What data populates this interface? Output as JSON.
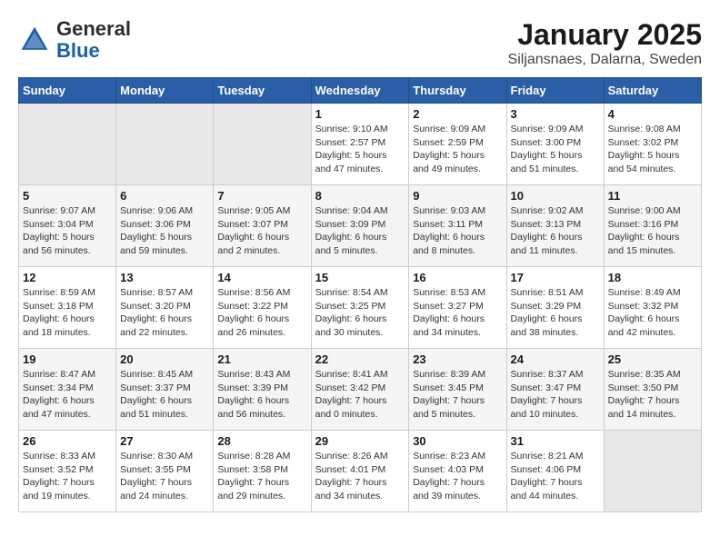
{
  "header": {
    "logo_general": "General",
    "logo_blue": "Blue",
    "month_title": "January 2025",
    "location": "Siljansnaes, Dalarna, Sweden"
  },
  "weekdays": [
    "Sunday",
    "Monday",
    "Tuesday",
    "Wednesday",
    "Thursday",
    "Friday",
    "Saturday"
  ],
  "weeks": [
    [
      {
        "day": "",
        "info": ""
      },
      {
        "day": "",
        "info": ""
      },
      {
        "day": "",
        "info": ""
      },
      {
        "day": "1",
        "info": "Sunrise: 9:10 AM\nSunset: 2:57 PM\nDaylight: 5 hours\nand 47 minutes."
      },
      {
        "day": "2",
        "info": "Sunrise: 9:09 AM\nSunset: 2:59 PM\nDaylight: 5 hours\nand 49 minutes."
      },
      {
        "day": "3",
        "info": "Sunrise: 9:09 AM\nSunset: 3:00 PM\nDaylight: 5 hours\nand 51 minutes."
      },
      {
        "day": "4",
        "info": "Sunrise: 9:08 AM\nSunset: 3:02 PM\nDaylight: 5 hours\nand 54 minutes."
      }
    ],
    [
      {
        "day": "5",
        "info": "Sunrise: 9:07 AM\nSunset: 3:04 PM\nDaylight: 5 hours\nand 56 minutes."
      },
      {
        "day": "6",
        "info": "Sunrise: 9:06 AM\nSunset: 3:06 PM\nDaylight: 5 hours\nand 59 minutes."
      },
      {
        "day": "7",
        "info": "Sunrise: 9:05 AM\nSunset: 3:07 PM\nDaylight: 6 hours\nand 2 minutes."
      },
      {
        "day": "8",
        "info": "Sunrise: 9:04 AM\nSunset: 3:09 PM\nDaylight: 6 hours\nand 5 minutes."
      },
      {
        "day": "9",
        "info": "Sunrise: 9:03 AM\nSunset: 3:11 PM\nDaylight: 6 hours\nand 8 minutes."
      },
      {
        "day": "10",
        "info": "Sunrise: 9:02 AM\nSunset: 3:13 PM\nDaylight: 6 hours\nand 11 minutes."
      },
      {
        "day": "11",
        "info": "Sunrise: 9:00 AM\nSunset: 3:16 PM\nDaylight: 6 hours\nand 15 minutes."
      }
    ],
    [
      {
        "day": "12",
        "info": "Sunrise: 8:59 AM\nSunset: 3:18 PM\nDaylight: 6 hours\nand 18 minutes."
      },
      {
        "day": "13",
        "info": "Sunrise: 8:57 AM\nSunset: 3:20 PM\nDaylight: 6 hours\nand 22 minutes."
      },
      {
        "day": "14",
        "info": "Sunrise: 8:56 AM\nSunset: 3:22 PM\nDaylight: 6 hours\nand 26 minutes."
      },
      {
        "day": "15",
        "info": "Sunrise: 8:54 AM\nSunset: 3:25 PM\nDaylight: 6 hours\nand 30 minutes."
      },
      {
        "day": "16",
        "info": "Sunrise: 8:53 AM\nSunset: 3:27 PM\nDaylight: 6 hours\nand 34 minutes."
      },
      {
        "day": "17",
        "info": "Sunrise: 8:51 AM\nSunset: 3:29 PM\nDaylight: 6 hours\nand 38 minutes."
      },
      {
        "day": "18",
        "info": "Sunrise: 8:49 AM\nSunset: 3:32 PM\nDaylight: 6 hours\nand 42 minutes."
      }
    ],
    [
      {
        "day": "19",
        "info": "Sunrise: 8:47 AM\nSunset: 3:34 PM\nDaylight: 6 hours\nand 47 minutes."
      },
      {
        "day": "20",
        "info": "Sunrise: 8:45 AM\nSunset: 3:37 PM\nDaylight: 6 hours\nand 51 minutes."
      },
      {
        "day": "21",
        "info": "Sunrise: 8:43 AM\nSunset: 3:39 PM\nDaylight: 6 hours\nand 56 minutes."
      },
      {
        "day": "22",
        "info": "Sunrise: 8:41 AM\nSunset: 3:42 PM\nDaylight: 7 hours\nand 0 minutes."
      },
      {
        "day": "23",
        "info": "Sunrise: 8:39 AM\nSunset: 3:45 PM\nDaylight: 7 hours\nand 5 minutes."
      },
      {
        "day": "24",
        "info": "Sunrise: 8:37 AM\nSunset: 3:47 PM\nDaylight: 7 hours\nand 10 minutes."
      },
      {
        "day": "25",
        "info": "Sunrise: 8:35 AM\nSunset: 3:50 PM\nDaylight: 7 hours\nand 14 minutes."
      }
    ],
    [
      {
        "day": "26",
        "info": "Sunrise: 8:33 AM\nSunset: 3:52 PM\nDaylight: 7 hours\nand 19 minutes."
      },
      {
        "day": "27",
        "info": "Sunrise: 8:30 AM\nSunset: 3:55 PM\nDaylight: 7 hours\nand 24 minutes."
      },
      {
        "day": "28",
        "info": "Sunrise: 8:28 AM\nSunset: 3:58 PM\nDaylight: 7 hours\nand 29 minutes."
      },
      {
        "day": "29",
        "info": "Sunrise: 8:26 AM\nSunset: 4:01 PM\nDaylight: 7 hours\nand 34 minutes."
      },
      {
        "day": "30",
        "info": "Sunrise: 8:23 AM\nSunset: 4:03 PM\nDaylight: 7 hours\nand 39 minutes."
      },
      {
        "day": "31",
        "info": "Sunrise: 8:21 AM\nSunset: 4:06 PM\nDaylight: 7 hours\nand 44 minutes."
      },
      {
        "day": "",
        "info": ""
      }
    ]
  ]
}
